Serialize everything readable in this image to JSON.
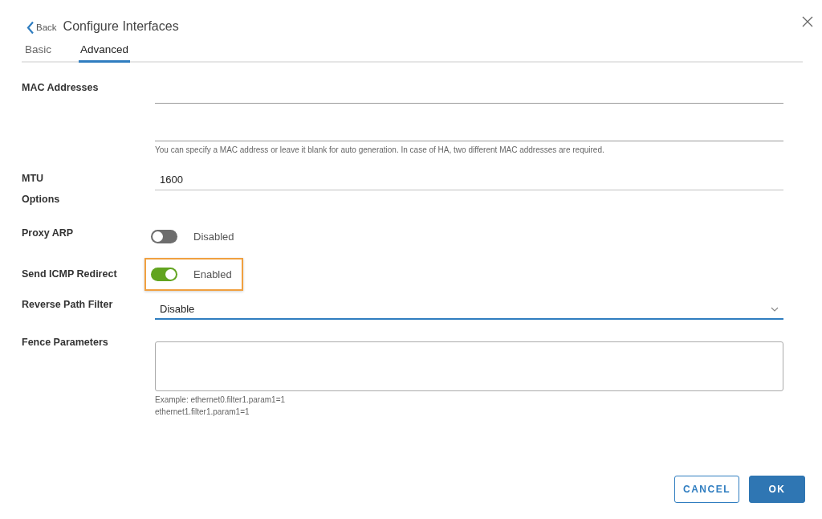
{
  "dialog": {
    "back_label": "Back",
    "title": "Configure Interfaces"
  },
  "tabs": [
    {
      "label": "Basic",
      "selected": false
    },
    {
      "label": "Advanced",
      "selected": true
    }
  ],
  "fields": [
    {
      "kind": "mac",
      "label": "MAC Addresses",
      "hint": "You can specify a MAC address or leave it blank for auto generation. In case of HA, two different MAC addresses are required."
    },
    {
      "kind": "text",
      "label": "MTU",
      "value": "1600"
    },
    {
      "kind": "heading",
      "label": "Options"
    },
    {
      "kind": "toggle",
      "label": "Proxy ARP",
      "on": false,
      "state_text": "Disabled",
      "highlighted": false
    },
    {
      "kind": "toggle",
      "label": "Send ICMP Redirect",
      "on": true,
      "state_text": "Enabled",
      "highlighted": true
    },
    {
      "kind": "select",
      "label": "Reverse Path Filter",
      "value": "Disable"
    },
    {
      "kind": "textarea",
      "label": "Fence Parameters",
      "hints": [
        "Example: ethernet0.filter1.param1=1",
        "ethernet1.filter1.param1=1"
      ]
    }
  ],
  "buttons": [
    {
      "label": "CANCEL",
      "kind": "secondary"
    },
    {
      "label": "OK",
      "kind": "primary"
    }
  ]
}
